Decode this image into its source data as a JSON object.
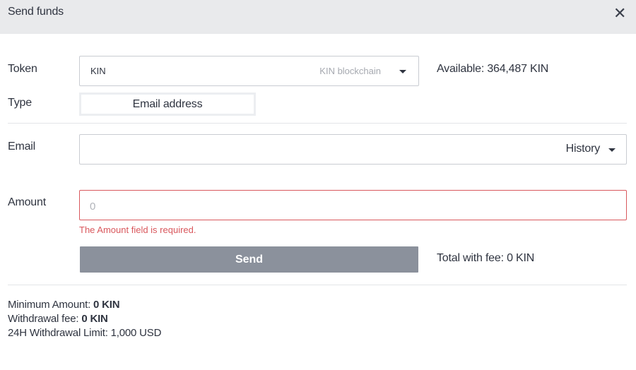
{
  "header": {
    "title": "Send funds",
    "close_glyph": "✕"
  },
  "form": {
    "token": {
      "label": "Token",
      "value": "KIN",
      "network": "KIN blockchain"
    },
    "available": "Available: 364,487 KIN",
    "type": {
      "label": "Type",
      "value": "Email address"
    },
    "email": {
      "label": "Email",
      "value": "",
      "history_label": "History"
    },
    "amount": {
      "label": "Amount",
      "placeholder": "0",
      "value": "",
      "error": "The Amount field is required."
    },
    "send_label": "Send",
    "total_with_fee": "Total with fee: 0 KIN"
  },
  "info": {
    "minimum_label": "Minimum Amount: ",
    "minimum_value": "0 KIN",
    "fee_label": "Withdrawal fee: ",
    "fee_value": "0 KIN",
    "limit_text": "24H Withdrawal Limit: 1,000 USD"
  },
  "colors": {
    "header_bg": "#e9eaec",
    "error": "#d9585d",
    "send_button_bg": "#8b919c"
  }
}
